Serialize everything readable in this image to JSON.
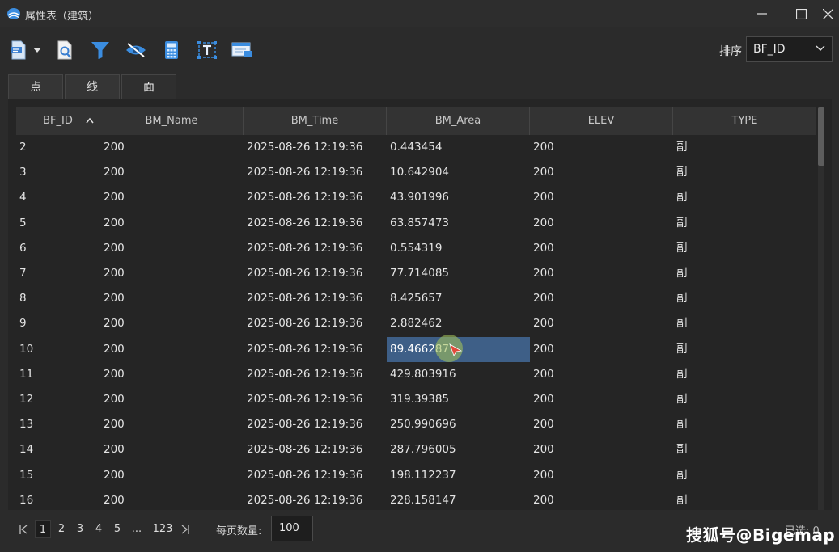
{
  "window": {
    "title": "属性表（建筑）"
  },
  "toolbar": {
    "tools": [
      "export-icon",
      "dropdown-chevron-icon",
      "zoom-to-icon",
      "filter-icon",
      "visibility-icon",
      "calculator-icon",
      "text-field-icon",
      "window-icon"
    ],
    "sort_label": "排序",
    "sort_value": "BF_ID"
  },
  "tabs": [
    {
      "label": "点"
    },
    {
      "label": "线"
    },
    {
      "label": "面"
    }
  ],
  "active_tab": "面",
  "table": {
    "columns": [
      "BF_ID",
      "BM_Name",
      "BM_Time",
      "BM_Area",
      "ELEV",
      "TYPE"
    ],
    "sorted_by": "BF_ID",
    "rows": [
      [
        "2",
        "200",
        "2025-08-26 12:19:36",
        "0.443454",
        "200",
        "副"
      ],
      [
        "3",
        "200",
        "2025-08-26 12:19:36",
        "10.642904",
        "200",
        "副"
      ],
      [
        "4",
        "200",
        "2025-08-26 12:19:36",
        "43.901996",
        "200",
        "副"
      ],
      [
        "5",
        "200",
        "2025-08-26 12:19:36",
        "63.857473",
        "200",
        "副"
      ],
      [
        "6",
        "200",
        "2025-08-26 12:19:36",
        "0.554319",
        "200",
        "副"
      ],
      [
        "7",
        "200",
        "2025-08-26 12:19:36",
        "77.714085",
        "200",
        "副"
      ],
      [
        "8",
        "200",
        "2025-08-26 12:19:36",
        "8.425657",
        "200",
        "副"
      ],
      [
        "9",
        "200",
        "2025-08-26 12:19:36",
        "2.882462",
        "200",
        "副"
      ],
      [
        "10",
        "200",
        "2025-08-26 12:19:36",
        "89.466287",
        "200",
        "副"
      ],
      [
        "11",
        "200",
        "2025-08-26 12:19:36",
        "429.803916",
        "200",
        "副"
      ],
      [
        "12",
        "200",
        "2025-08-26 12:19:36",
        "319.39385",
        "200",
        "副"
      ],
      [
        "13",
        "200",
        "2025-08-26 12:19:36",
        "250.990696",
        "200",
        "副"
      ],
      [
        "14",
        "200",
        "2025-08-26 12:19:36",
        "287.796005",
        "200",
        "副"
      ],
      [
        "15",
        "200",
        "2025-08-26 12:19:36",
        "198.112237",
        "200",
        "副"
      ],
      [
        "16",
        "200",
        "2025-08-26 12:19:36",
        "228.158147",
        "200",
        "副"
      ]
    ],
    "selected_cell": {
      "row": 8,
      "col": 3
    }
  },
  "pagination": {
    "pages": [
      "1",
      "2",
      "3",
      "4",
      "5",
      "...",
      "123"
    ],
    "current": "1",
    "per_page_label": "每页数量:",
    "per_page_value": "100",
    "selected_count": "已选: 0"
  },
  "watermark": "搜狐号@Bigemap",
  "colors": {
    "selection": "#3e5f87",
    "background": "#2b2b2b",
    "accent": "#3b8de0"
  }
}
